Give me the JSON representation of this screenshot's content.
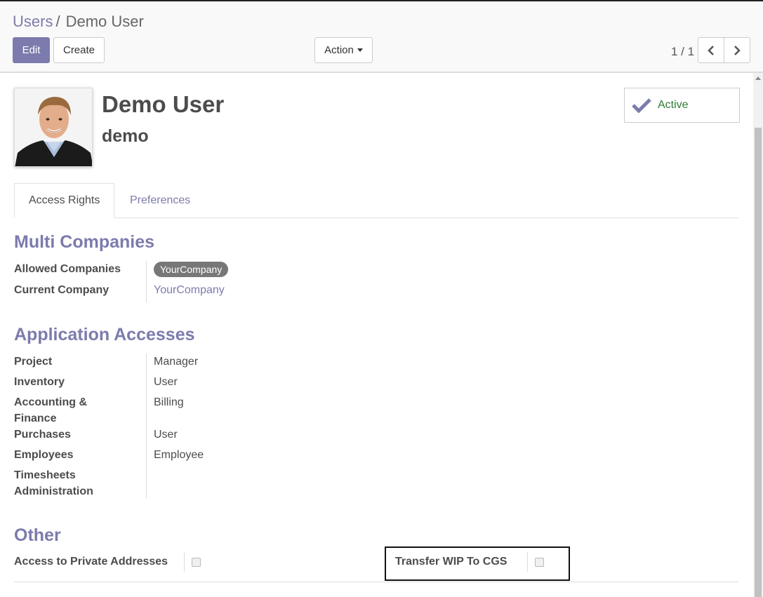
{
  "breadcrumb": {
    "parent": "Users",
    "separator": "/",
    "current": "Demo User"
  },
  "buttons": {
    "edit": "Edit",
    "create": "Create",
    "action": "Action"
  },
  "pager": {
    "value": "1 / 1"
  },
  "user": {
    "name": "Demo User",
    "login": "demo"
  },
  "status": {
    "active_label": "Active",
    "active_color": "#2e7d32"
  },
  "tabs": [
    {
      "label": "Access Rights"
    },
    {
      "label": "Preferences"
    }
  ],
  "multi_companies": {
    "title": "Multi Companies",
    "allowed_label": "Allowed Companies",
    "allowed_tag": "YourCompany",
    "current_label": "Current Company",
    "current_value": "YourCompany"
  },
  "application_accesses": {
    "title": "Application Accesses",
    "rows": [
      {
        "label": "Project",
        "value": "Manager"
      },
      {
        "label": "Inventory",
        "value": "User"
      },
      {
        "label": "Accounting & Finance",
        "value": "Billing"
      },
      {
        "label": "Purchases",
        "value": "User"
      },
      {
        "label": "Employees",
        "value": "Employee"
      },
      {
        "label": "Timesheets Administration",
        "value": ""
      }
    ]
  },
  "other": {
    "title": "Other",
    "private_addresses_label": "Access to Private Addresses",
    "transfer_label": "Transfer WIP To CGS"
  },
  "colors": {
    "brand": "#7c7bad",
    "text": "#4c4c4c"
  }
}
